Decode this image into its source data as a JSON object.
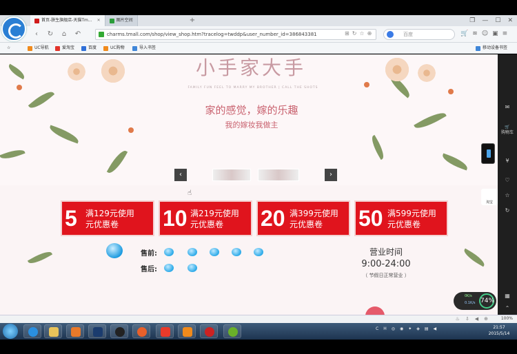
{
  "browser": {
    "tabs": [
      {
        "label": "首页-朕生旗舰店-天猫Tm...",
        "color": "#d01b1b"
      },
      {
        "label": "图片空间",
        "color": "#2a9d3a"
      }
    ],
    "new_tab": "+",
    "url": "charms.tmall.com/shop/view_shop.htm?tracelog=twddp&user_number_id=386843381",
    "search_placeholder": "百度",
    "bookmarks": [
      {
        "label": "UC导航",
        "color": "#f08a1c"
      },
      {
        "label": "爱淘宝",
        "color": "#e2332a"
      },
      {
        "label": "百度",
        "color": "#2f6fd8"
      },
      {
        "label": "UC购物",
        "color": "#f08a1c"
      },
      {
        "label": "导入书签",
        "color": "#3f86d8"
      }
    ],
    "mobile_bookmarks": "移动设备书签"
  },
  "banner": {
    "brand": "小手家大手",
    "brand_sub": "FAMILY FUN FEEL TO MARRY MY BROTHER | CALL THE SHOTS",
    "tagline1": "家的感觉，嫁的乐趣",
    "tagline2": "我的嫁妆我做主",
    "prev_icon": "‹",
    "next_icon": "›"
  },
  "coupons": [
    {
      "amount": "5",
      "line1": "满129元使用",
      "line2": "元优惠卷"
    },
    {
      "amount": "10",
      "line1": "满219元使用",
      "line2": "元优惠卷"
    },
    {
      "amount": "20",
      "line1": "满399元使用",
      "line2": "元优惠卷"
    },
    {
      "amount": "50",
      "line1": "满599元使用",
      "line2": "元优惠卷"
    }
  ],
  "service": {
    "presale_label": "售前:",
    "aftersale_label": "售后:"
  },
  "hours": {
    "title": "营业时间",
    "time": "9:00-24:00",
    "note": "（ 节假日正常营业 ）"
  },
  "sidebar": {
    "cart_label": "购物车",
    "app_label": "淘宝"
  },
  "speed_widget": {
    "up": "0K/s",
    "down": "0.1K/s",
    "percent": "74%"
  },
  "statusbar": {
    "zoom": "100%"
  },
  "clock": {
    "time": "21:57",
    "date": "2015/5/14"
  },
  "colors": {
    "accent": "#e0141d",
    "tagline": "#c9626f"
  }
}
